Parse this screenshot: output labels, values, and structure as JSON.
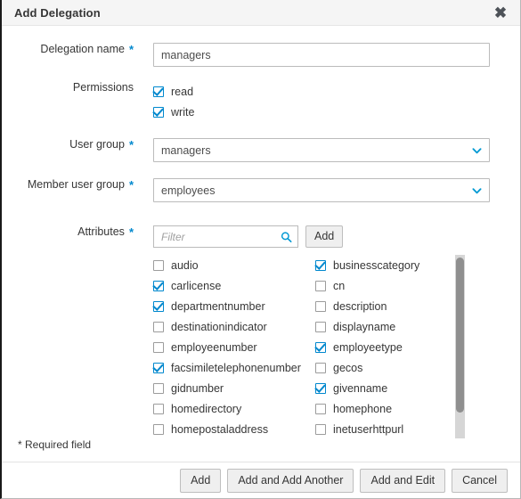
{
  "dialog": {
    "title": "Add Delegation",
    "close_icon": "close-icon",
    "required_note": "* Required field"
  },
  "form": {
    "delegation_name": {
      "label": "Delegation name",
      "required": "*",
      "value": "managers",
      "placeholder": ""
    },
    "permissions": {
      "label": "Permissions",
      "options": [
        {
          "label": "read",
          "checked": true
        },
        {
          "label": "write",
          "checked": true
        }
      ]
    },
    "user_group": {
      "label": "User group",
      "required": "*",
      "value": "managers"
    },
    "member_user_group": {
      "label": "Member user group",
      "required": "*",
      "value": "employees"
    },
    "attributes": {
      "label": "Attributes",
      "required": "*",
      "filter_placeholder": "Filter",
      "filter_value": "",
      "search_icon": "search-icon",
      "add_button": "Add",
      "left_column": [
        {
          "label": "audio",
          "checked": false
        },
        {
          "label": "carlicense",
          "checked": true
        },
        {
          "label": "departmentnumber",
          "checked": true
        },
        {
          "label": "destinationindicator",
          "checked": false
        },
        {
          "label": "employeenumber",
          "checked": false
        },
        {
          "label": "facsimiletelephonenumber",
          "checked": true
        },
        {
          "label": "gidnumber",
          "checked": false
        },
        {
          "label": "homedirectory",
          "checked": false
        },
        {
          "label": "homepostaladdress",
          "checked": false
        }
      ],
      "right_column": [
        {
          "label": "businesscategory",
          "checked": true
        },
        {
          "label": "cn",
          "checked": false
        },
        {
          "label": "description",
          "checked": false
        },
        {
          "label": "displayname",
          "checked": false
        },
        {
          "label": "employeetype",
          "checked": true
        },
        {
          "label": "gecos",
          "checked": false
        },
        {
          "label": "givenname",
          "checked": true
        },
        {
          "label": "homephone",
          "checked": false
        },
        {
          "label": "inetuserhttpurl",
          "checked": false
        }
      ]
    }
  },
  "footer": {
    "buttons": [
      {
        "label": "Add"
      },
      {
        "label": "Add and Add Another"
      },
      {
        "label": "Add and Edit"
      },
      {
        "label": "Cancel"
      }
    ]
  },
  "colors": {
    "accent": "#0088ce",
    "header_bg": "#f5f5f5",
    "text": "#363636",
    "border": "#bbbbbb"
  }
}
